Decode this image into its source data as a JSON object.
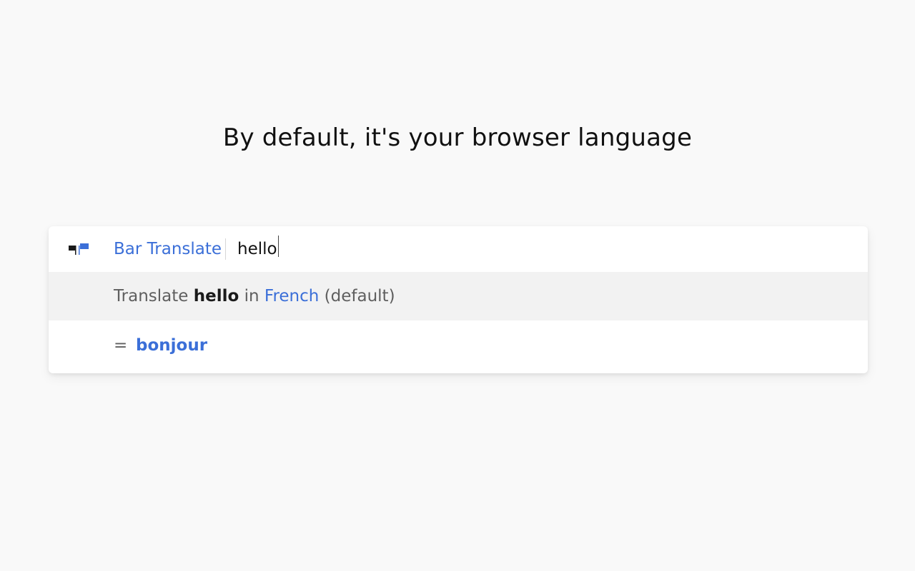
{
  "headline": "By default, it's your browser language",
  "bar": {
    "keyword": "Bar Translate",
    "query_value": "hello",
    "flag_icon": "flag-icon"
  },
  "suggestion": {
    "prefix": "Translate",
    "word": "hello",
    "middle": "in",
    "language": "French",
    "suffix": "(default)"
  },
  "result": {
    "equals": "=",
    "translation": "bonjour"
  },
  "colors": {
    "accent": "#3b6fd8",
    "background": "#f9f9f9",
    "highlight_row": "#f2f2f2"
  }
}
